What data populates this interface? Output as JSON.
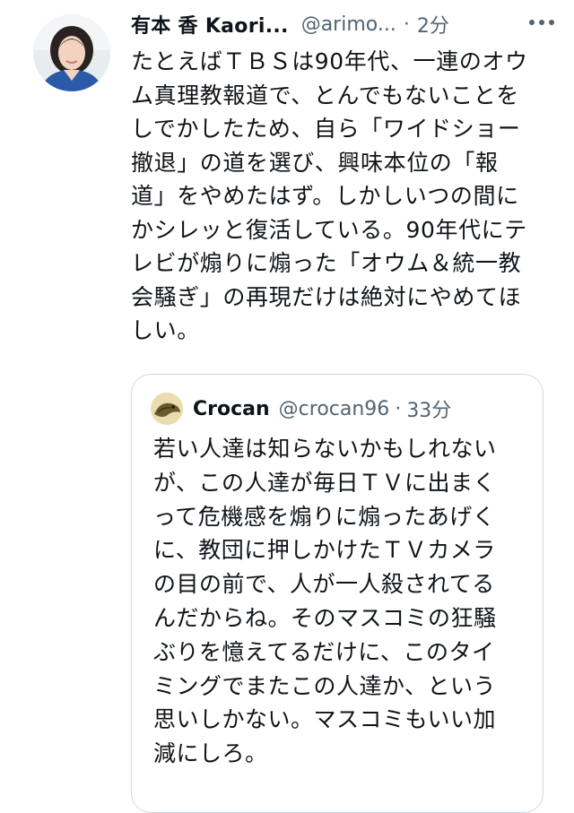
{
  "tweet": {
    "author": {
      "display_name": "有本 香 Kaori...",
      "handle": "@arimo...",
      "avatar_icon": "profile-photo"
    },
    "dot": "·",
    "time": "2分",
    "more_icon": "more-horizontal-icon",
    "text": "たとえばＴＢＳは90年代、一連のオウ\nム真理教報道で、とんでもないことを\nしでかしたため、自ら「ワイドショー\n撤退」の道を選び、興味本位の「報\n道」をやめたはず。しかしいつの間に\nかシレッと復活している。90年代にテ\nレビが煽りに煽った「オウム＆統一教\n会騒ぎ」の再現だけは絶対にやめてほ\nしい。"
  },
  "quote": {
    "author": {
      "display_name": "Crocan",
      "handle": "@crocan96",
      "avatar_icon": "crocan-avatar"
    },
    "dot": "·",
    "time": "33分",
    "text": "若い人達は知らないかもしれない\nが、この人達が毎日ＴＶに出まく\nって危機感を煽りに煽ったあげく\nに、教団に押しかけたＴＶカメラ\nの目の前で、人が一人殺されてる\nんだからね。そのマスコミの狂騒\nぶりを憶えてるだけに、このタイ\nミングでまたこの人達か、という\n思いしかない。マスコミもいい加\n減にしろ。"
  },
  "colors": {
    "text_primary": "#0f1419",
    "text_secondary": "#536471",
    "border": "#cfd9de"
  }
}
